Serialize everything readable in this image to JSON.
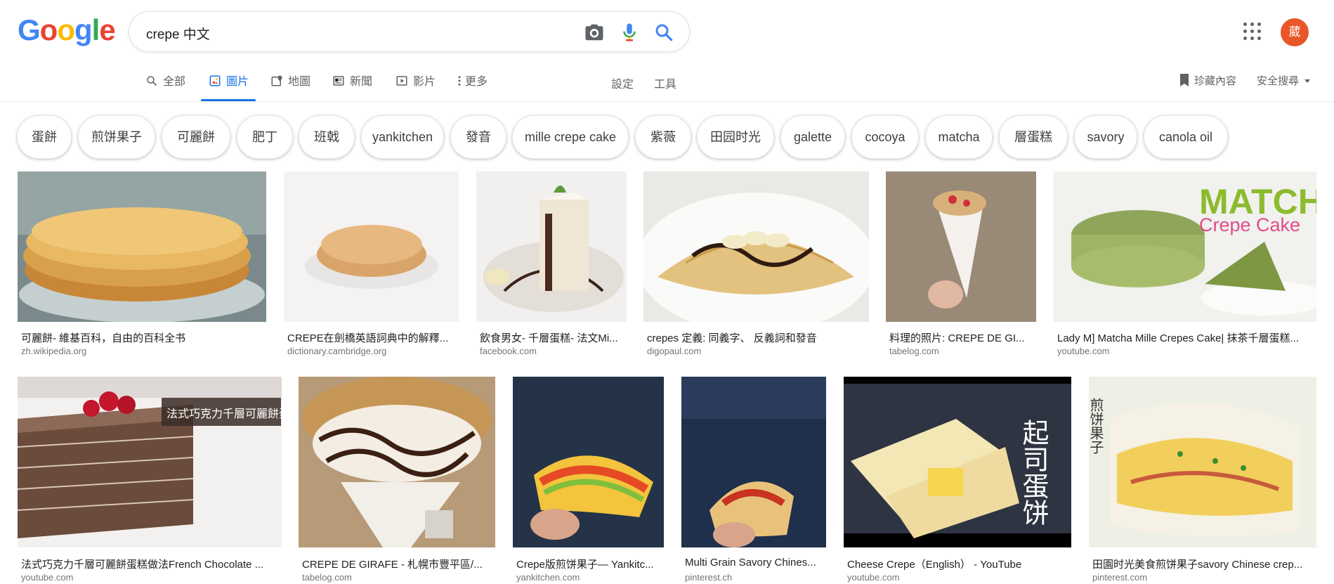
{
  "logo": {
    "letters": [
      "G",
      "o",
      "o",
      "g",
      "l",
      "e"
    ],
    "colors": [
      "#4285f4",
      "#ea4335",
      "#fbbc05",
      "#4285f4",
      "#34a853",
      "#ea4335"
    ]
  },
  "search": {
    "query": "crepe 中文",
    "icons": [
      "camera-icon",
      "mic-icon",
      "search-icon"
    ]
  },
  "account": {
    "avatar_text": "葳",
    "avatar_color": "#e8562a"
  },
  "tabs": [
    {
      "label": "全部",
      "icon": "search-icon"
    },
    {
      "label": "圖片",
      "icon": "image-icon"
    },
    {
      "label": "地圖",
      "icon": "map-icon"
    },
    {
      "label": "新聞",
      "icon": "news-icon"
    },
    {
      "label": "影片",
      "icon": "video-icon"
    },
    {
      "label": "更多",
      "icon": "more-vert-icon"
    }
  ],
  "tools": {
    "settings": "設定",
    "tools": "工具",
    "saved": "珍藏內容",
    "safesearch": "安全搜尋"
  },
  "chips": [
    "蛋餅",
    "煎饼果子",
    "可麗餅",
    "肥丁",
    "班戟",
    "yankitchen",
    "發音",
    "mille crepe cake",
    "紫薇",
    "田园时光",
    "galette",
    "cocoya",
    "matcha",
    "層蛋糕",
    "savory",
    "canola oil"
  ],
  "results_row1": [
    {
      "title": "可麗餅- 維基百科，自由的百科全书",
      "site": "zh.wikipedia.org"
    },
    {
      "title": "CREPE在劍橋英語詞典中的解釋...",
      "site": "dictionary.cambridge.org"
    },
    {
      "title": "飲食男女- 千層蛋糕- 法文Mi...",
      "site": "facebook.com"
    },
    {
      "title": "crepes 定義: 同義字、 反義詞和發音",
      "site": "digopaul.com"
    },
    {
      "title": "料理的照片: CREPE DE GI...",
      "site": "tabelog.com"
    },
    {
      "title": "Lady M] Matcha Mille Crepes Cake| 抹茶千層蛋糕...",
      "site": "youtube.com",
      "overlay_title": "MATCHA",
      "overlay_sub": "Crepe Cake"
    }
  ],
  "results_row2": [
    {
      "title": "法式巧克力千層可麗餅蛋糕做法French Chocolate ...",
      "site": "youtube.com",
      "overlay": "法式巧克力千層可麗餅蛋糕"
    },
    {
      "title": "CREPE DE GIRAFE - 札幌市豐平區/...",
      "site": "tabelog.com"
    },
    {
      "title": "Crepe版煎饼果子— Yankitc...",
      "site": "yankitchen.com"
    },
    {
      "title": "Multi Grain Savory Chines...",
      "site": "pinterest.ch"
    },
    {
      "title": "Cheese Crepe（English） - YouTube",
      "site": "youtube.com",
      "overlay": "起司蛋饼"
    },
    {
      "title": "田園时光美食煎饼果子savory Chinese crep...",
      "site": "pinterest.com",
      "overlay": "煎饼果子"
    }
  ]
}
